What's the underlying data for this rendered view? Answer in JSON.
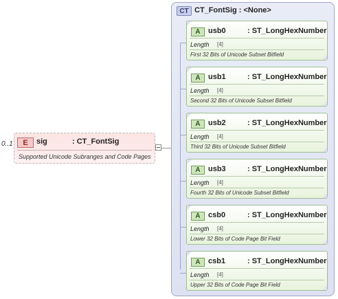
{
  "element": {
    "occurs": "0..1",
    "badge": "E",
    "name": "sig",
    "type": ": CT_FontSig",
    "description": "Supported Unicode Subranges and Code Pages"
  },
  "complex_type": {
    "badge": "CT",
    "title": "CT_FontSig : <None>"
  },
  "attributes": [
    {
      "badge": "A",
      "name": "usb0",
      "type": ": ST_LongHexNumber",
      "facet_label": "Length",
      "facet_value": "[4]",
      "description": "First 32 Bits of Unicode Subset Bitfield"
    },
    {
      "badge": "A",
      "name": "usb1",
      "type": ": ST_LongHexNumber",
      "facet_label": "Length",
      "facet_value": "[4]",
      "description": "Second 32 Bits of Unicode Subset Bitfield"
    },
    {
      "badge": "A",
      "name": "usb2",
      "type": ": ST_LongHexNumber",
      "facet_label": "Length",
      "facet_value": "[4]",
      "description": "Third 32 Bits of Unicode Subset Bitfield"
    },
    {
      "badge": "A",
      "name": "usb3",
      "type": ": ST_LongHexNumber",
      "facet_label": "Length",
      "facet_value": "[4]",
      "description": "Fourth 32 Bits of Unicode Subset Bitfield"
    },
    {
      "badge": "A",
      "name": "csb0",
      "type": ": ST_LongHexNumber",
      "facet_label": "Length",
      "facet_value": "[4]",
      "description": "Lower 32 Bits of Code Page Bit Field"
    },
    {
      "badge": "A",
      "name": "csb1",
      "type": ": ST_LongHexNumber",
      "facet_label": "Length",
      "facet_value": "[4]",
      "description": "Upper 32 Bits of Code Page Bit Field"
    }
  ]
}
